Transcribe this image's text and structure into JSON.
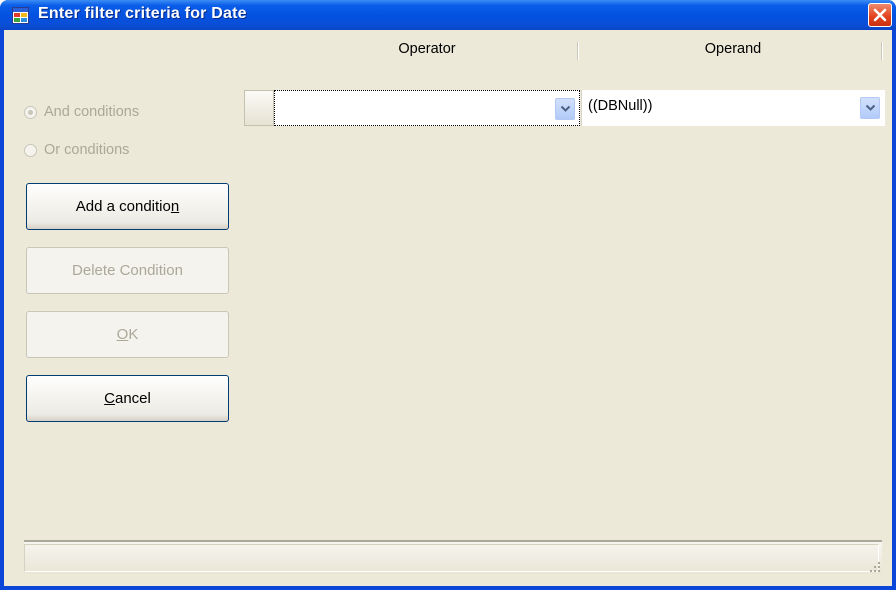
{
  "window": {
    "title": "Enter filter criteria for Date",
    "icon": "app-window-icon",
    "close_icon": "close-icon"
  },
  "logic": {
    "and_label": "And conditions",
    "or_label": "Or conditions",
    "selected": "and"
  },
  "buttons": {
    "add_pre": "Add a conditio",
    "add_mnemonic": "n",
    "delete": "Delete Condition",
    "ok_mnemonic": "O",
    "ok_rest": "K",
    "cancel_mnemonic": "C",
    "cancel_rest": "ancel"
  },
  "grid": {
    "columns": [
      "Operator",
      "Operand"
    ],
    "rows": [
      {
        "operator": "",
        "operand": "((DBNull))"
      }
    ]
  },
  "colors": {
    "titlebar": "#0450e0",
    "client": "#ece9d8",
    "button_border": "#003c74",
    "disabled_text": "#aca899",
    "close": "#e2411b"
  }
}
